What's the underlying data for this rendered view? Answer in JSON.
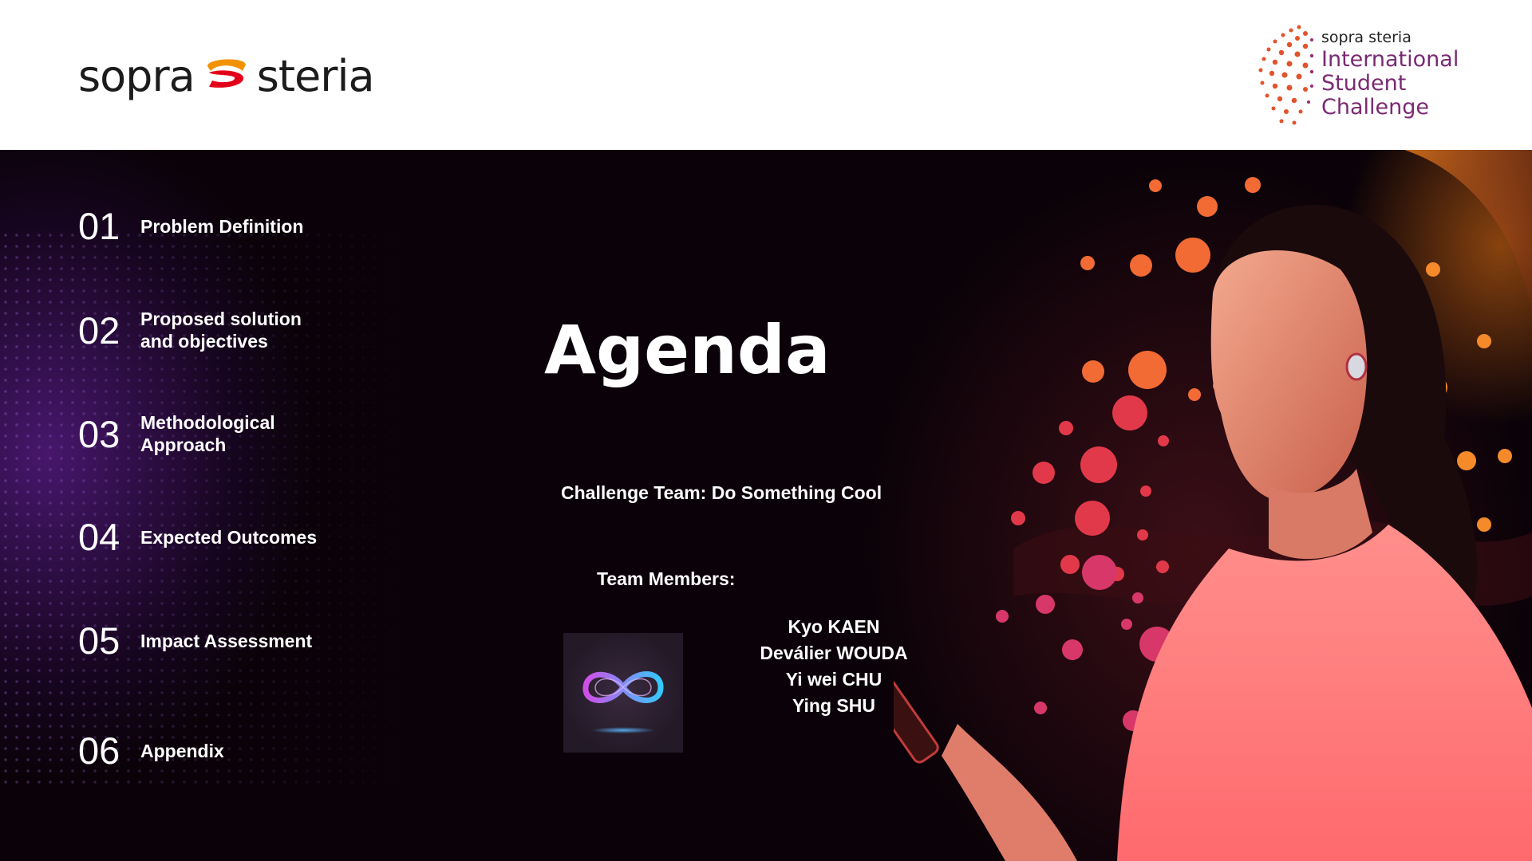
{
  "header": {
    "brand_left": "sopra",
    "brand_right": "steria",
    "badge": {
      "brand": "sopra steria",
      "lines": [
        "International",
        "Student",
        "Challenge"
      ]
    }
  },
  "agenda": {
    "title": "Agenda",
    "items": [
      {
        "num": "01",
        "label": "Problem Definition"
      },
      {
        "num": "02",
        "label": "Proposed solution and objectives"
      },
      {
        "num": "03",
        "label": "Methodological Approach"
      },
      {
        "num": "04",
        "label": "Expected Outcomes"
      },
      {
        "num": "05",
        "label": "Impact Assessment"
      },
      {
        "num": "06",
        "label": "Appendix"
      }
    ]
  },
  "team": {
    "challenge_line": "Challenge Team: Do Something Cool",
    "members_heading": "Team Members:",
    "members": [
      "Kyo KAEN",
      "Deválier WOUDA",
      "Yi wei CHU",
      "Ying SHU"
    ]
  },
  "colors": {
    "brand_orange": "#f39200",
    "brand_red": "#e3001b",
    "badge_purple": "#7a2a72",
    "background": "#0a0208"
  },
  "icons": [
    "sopra-steria-logo-icon",
    "isc-dots-icon",
    "infinity-circuit-icon"
  ]
}
